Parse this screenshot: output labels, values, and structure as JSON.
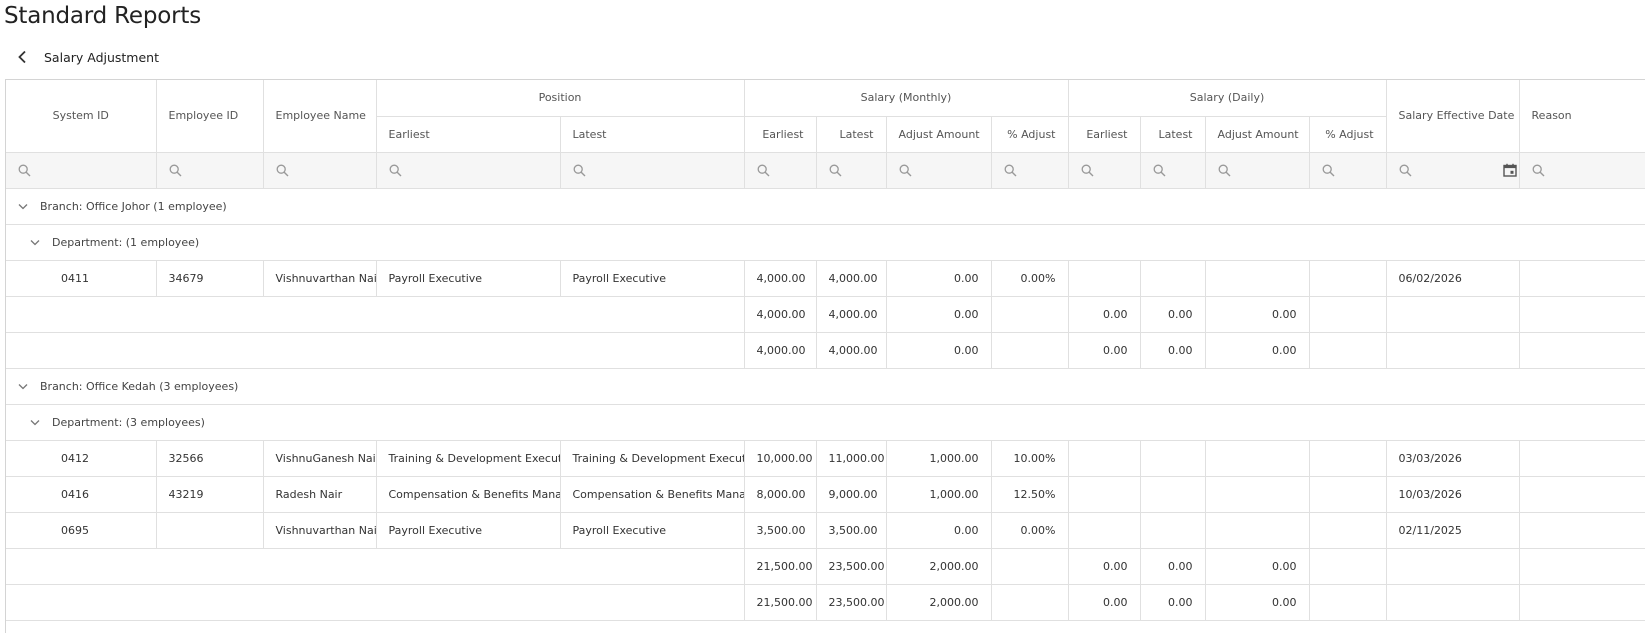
{
  "page": {
    "title": "Standard Reports",
    "report_name": "Salary Adjustment"
  },
  "columns": {
    "system_id": "System ID",
    "employee_id": "Employee ID",
    "employee_name": "Employee Name",
    "position": "Position",
    "salary_monthly": "Salary (Monthly)",
    "salary_daily": "Salary (Daily)",
    "effective_date": "Salary Effective Date",
    "reason": "Reason",
    "earliest": "Earliest",
    "latest": "Latest",
    "adjust_amount": "Adjust Amount",
    "pct_adjust": "% Adjust"
  },
  "icons": {
    "back": "chevron-left-icon",
    "search": "search-icon",
    "calendar": "calendar-icon",
    "collapse": "chevron-down-icon"
  },
  "groups": [
    {
      "branch_label": "Branch: Office Johor (1 employee)",
      "department_label": "Department: (1 employee)",
      "rows": [
        {
          "system_id": "0411",
          "employee_id": "34679",
          "name": "Vishnuvarthan Nair",
          "pos_earliest": "Payroll Executive",
          "pos_latest": "Payroll Executive",
          "m_earliest": "4,000.00",
          "m_latest": "4,000.00",
          "m_adjust": "0.00",
          "m_pct": "0.00%",
          "d_earliest": "",
          "d_latest": "",
          "d_adjust": "",
          "d_pct": "",
          "date": "06/02/2026",
          "reason": ""
        }
      ],
      "totals": [
        {
          "m_earliest": "4,000.00",
          "m_latest": "4,000.00",
          "m_adjust": "0.00",
          "d_earliest": "0.00",
          "d_latest": "0.00",
          "d_adjust": "0.00"
        },
        {
          "m_earliest": "4,000.00",
          "m_latest": "4,000.00",
          "m_adjust": "0.00",
          "d_earliest": "0.00",
          "d_latest": "0.00",
          "d_adjust": "0.00"
        }
      ]
    },
    {
      "branch_label": "Branch: Office Kedah (3 employees)",
      "department_label": "Department: (3 employees)",
      "rows": [
        {
          "system_id": "0412",
          "employee_id": "32566",
          "name": "VishnuGanesh Nair",
          "pos_earliest": "Training & Development Executive",
          "pos_latest": "Training & Development Executive",
          "m_earliest": "10,000.00",
          "m_latest": "11,000.00",
          "m_adjust": "1,000.00",
          "m_pct": "10.00%",
          "d_earliest": "",
          "d_latest": "",
          "d_adjust": "",
          "d_pct": "",
          "date": "03/03/2026",
          "reason": ""
        },
        {
          "system_id": "0416",
          "employee_id": "43219",
          "name": "Radesh Nair",
          "pos_earliest": "Compensation & Benefits Manager",
          "pos_latest": "Compensation & Benefits Manager",
          "m_earliest": "8,000.00",
          "m_latest": "9,000.00",
          "m_adjust": "1,000.00",
          "m_pct": "12.50%",
          "d_earliest": "",
          "d_latest": "",
          "d_adjust": "",
          "d_pct": "",
          "date": "10/03/2026",
          "reason": ""
        },
        {
          "system_id": "0695",
          "employee_id": "",
          "name": "Vishnuvarthan Nair",
          "pos_earliest": "Payroll Executive",
          "pos_latest": "Payroll Executive",
          "m_earliest": "3,500.00",
          "m_latest": "3,500.00",
          "m_adjust": "0.00",
          "m_pct": "0.00%",
          "d_earliest": "",
          "d_latest": "",
          "d_adjust": "",
          "d_pct": "",
          "date": "02/11/2025",
          "reason": ""
        }
      ],
      "totals": [
        {
          "m_earliest": "21,500.00",
          "m_latest": "23,500.00",
          "m_adjust": "2,000.00",
          "d_earliest": "0.00",
          "d_latest": "0.00",
          "d_adjust": "0.00"
        },
        {
          "m_earliest": "21,500.00",
          "m_latest": "23,500.00",
          "m_adjust": "2,000.00",
          "d_earliest": "0.00",
          "d_latest": "0.00",
          "d_adjust": "0.00"
        }
      ]
    }
  ]
}
